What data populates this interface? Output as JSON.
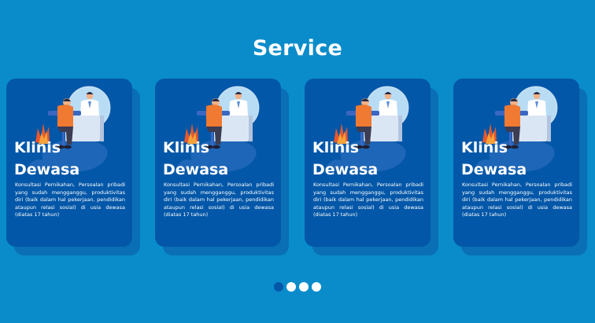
{
  "section": {
    "title": "Service"
  },
  "cards": [
    {
      "title_line1": "Klinis",
      "title_line2": "Dewasa",
      "description": "Konsultasi Pernikahan, Persoalan pribadi yang sudah mengganggu, produktivitas diri (baik dalam hal pekerjaan, pendidikan ataupun relasi sosial) di usia dewasa (diatas 17 tahun)"
    },
    {
      "title_line1": "Klinis",
      "title_line2": "Dewasa",
      "description": "Konsultasi Pernikahan, Persoalan pribadi yang sudah mengganggu, produktivitas diri (baik dalam hal pekerjaan, pendidikan ataupun relasi sosial) di usia dewasa (diatas 17 tahun)"
    },
    {
      "title_line1": "Klinis",
      "title_line2": "Dewasa",
      "description": "Konsultasi Pernikahan, Persoalan pribadi yang sudah mengganggu, produktivitas diri (baik dalam hal pekerjaan, pendidikan ataupun relasi sosial) di usia dewasa (diatas 17 tahun)"
    },
    {
      "title_line1": "Klinis",
      "title_line2": "Dewasa",
      "description": "Konsultasi Pernikahan, Persoalan pribadi yang sudah mengganggu, produktivitas diri (baik dalam hal pekerjaan, pendidikan ataupun relasi sosial) di usia dewasa (diatas 17 tahun)"
    }
  ],
  "illustration": {
    "icon": "doctor-consultation-illustration"
  },
  "pagination": {
    "count": 4,
    "active_index": 0
  },
  "colors": {
    "background": "#0a8ccb",
    "card": "#0357a8",
    "card_shadow": "#0a6fb5",
    "dot_active": "#0357a8",
    "dot_inactive": "#ffffff"
  }
}
